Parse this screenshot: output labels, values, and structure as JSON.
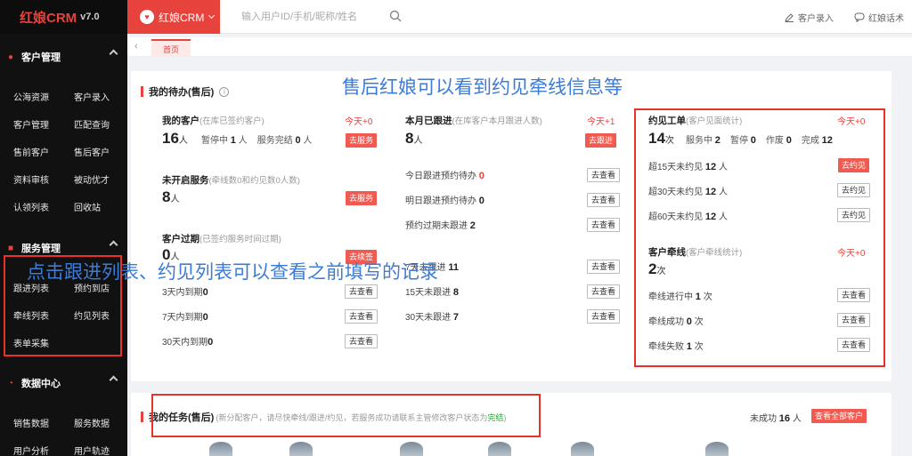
{
  "brand": {
    "logo": "红娘CRM",
    "version": "v7.0"
  },
  "sidebar": {
    "sections": [
      {
        "title": "客户管理",
        "icon": "users-icon",
        "items": [
          "公海资源",
          "客户录入",
          "客户管理",
          "匹配查询",
          "售前客户",
          "售后客户",
          "资料审核",
          "被动优才",
          "认领列表",
          "回收站"
        ]
      },
      {
        "title": "服务管理",
        "icon": "service-icon",
        "items": [
          "跟进列表",
          "预约到店",
          "牵线列表",
          "约见列表",
          "表单采集"
        ]
      },
      {
        "title": "数据中心",
        "icon": "pie-chart-icon",
        "items": [
          "销售数据",
          "服务数据",
          "用户分析",
          "用户轨迹"
        ]
      }
    ]
  },
  "topbar": {
    "app_label": "红娘CRM",
    "search_placeholder": "输入用户ID/手机/昵称/姓名",
    "customer_entry": "客户录入",
    "script_label": "红娘话术"
  },
  "tabs": {
    "home": "首页"
  },
  "todo": {
    "title": "我的待办(售后)",
    "my_customers": {
      "label": "我的客户",
      "hint": "(在库已签约客户)",
      "today": "今天+0",
      "count": "16",
      "unit": "人",
      "pause_label": "暂停中",
      "pause": "1",
      "done_label": "服务完结",
      "done": "0",
      "btn": "去服务"
    },
    "not_started": {
      "label": "未开启服务",
      "hint": "(牵线数0和约见数0人数)",
      "count": "8",
      "unit": "人",
      "btn": "去服务"
    },
    "expired": {
      "label": "客户过期",
      "hint": "(已签约服务时间过期)",
      "count": "0",
      "unit": "人",
      "btn": "去续签",
      "rows": [
        {
          "text": "3天内到期",
          "value": "0",
          "btn": "去查看"
        },
        {
          "text": "7天内到期",
          "value": "0",
          "btn": "去查看"
        },
        {
          "text": "30天内到期",
          "value": "0",
          "btn": "去查看"
        }
      ]
    },
    "followed": {
      "label": "本月已跟进",
      "hint": "(在库客户本月跟进人数)",
      "today": "今天+1",
      "count": "8",
      "unit": "人",
      "btn": "去跟进",
      "rows": [
        {
          "text": "今日跟进预约待办",
          "value": "0",
          "btn": "去查看"
        },
        {
          "text": "明日跟进预约待办",
          "value": "0",
          "btn": "去查看"
        },
        {
          "text": "预约过期未跟进",
          "value": "2",
          "btn": "去查看"
        }
      ],
      "rows2": [
        {
          "text": "7天未跟进",
          "value": "11",
          "btn": "去查看"
        },
        {
          "text": "15天未跟进",
          "value": "8",
          "btn": "去查看"
        },
        {
          "text": "30天未跟进",
          "value": "7",
          "btn": "去查看"
        }
      ]
    },
    "meet": {
      "label": "约见工单",
      "hint": "(客户见面统计)",
      "today": "今天+0",
      "count": "14",
      "unit": "次",
      "stats": [
        {
          "label": "服务中",
          "value": "2"
        },
        {
          "label": "暂停",
          "value": "0"
        },
        {
          "label": "作废",
          "value": "0"
        },
        {
          "label": "完成",
          "value": "12"
        }
      ],
      "rows": [
        {
          "text": "超15天未约见",
          "value": "12",
          "unit": "人",
          "btn": "去约见"
        },
        {
          "text": "超30天未约见",
          "value": "12",
          "unit": "人",
          "btn": "去约见"
        },
        {
          "text": "超60天未约见",
          "value": "12",
          "unit": "人",
          "btn": "去约见"
        }
      ]
    },
    "match": {
      "label": "客户牵线",
      "hint": "(客户牵线统计)",
      "today": "今天+0",
      "count": "2",
      "unit": "次",
      "rows": [
        {
          "text": "牵线进行中",
          "value": "1",
          "unit": "次",
          "btn": "去查看"
        },
        {
          "text": "牵线成功",
          "value": "0",
          "unit": "次",
          "btn": "去查看"
        },
        {
          "text": "牵线失败",
          "value": "1",
          "unit": "次",
          "btn": "去查看"
        }
      ]
    }
  },
  "tasks": {
    "title": "我的任务(售后)",
    "hint": "(新分配客户，请尽快牵线/跟进/约见，若服务成功请联系主管修改客户状态为",
    "hint_done": "完结",
    "hint_end": ")",
    "unsuccessful_label": "未成功",
    "unsuccessful_count": "16",
    "unsuccessful_unit": "人",
    "view_all": "查看全部客户"
  },
  "annotations": {
    "top": "售后红娘可以看到约见牵线信息等",
    "middle": "点击跟进列表、约见列表可以查看之前填写的记录"
  },
  "colors": {
    "accent": "#e8423c",
    "annotation": "#3d7cd6",
    "highlight_box": "#e8312b"
  }
}
